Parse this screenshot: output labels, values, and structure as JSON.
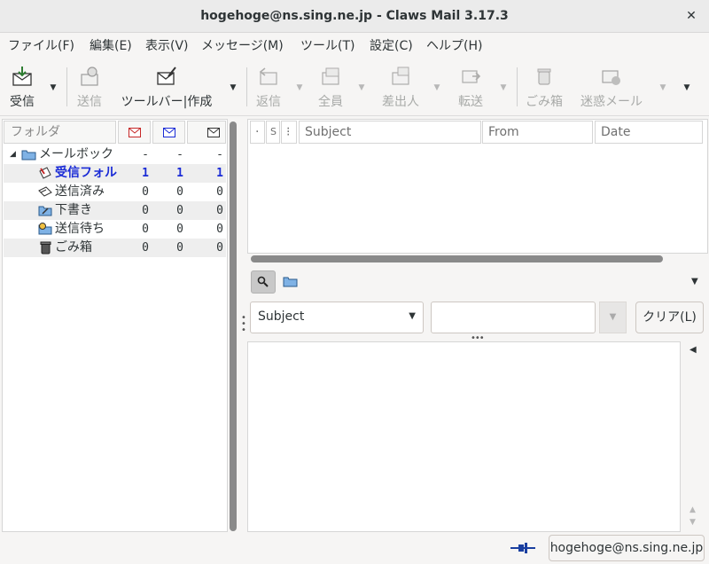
{
  "window": {
    "title": "hogehoge@ns.sing.ne.jp - Claws Mail 3.17.3",
    "close_symbol": "✕"
  },
  "menubar": [
    "ファイル(F)",
    "編集(E)",
    "表示(V)",
    "メッセージ(M)",
    "ツール(T)",
    "設定(C)",
    "ヘルプ(H)"
  ],
  "toolbar": {
    "receive": "受信",
    "send": "送信",
    "compose": "ツールバー|作成",
    "reply": "返信",
    "reply_all": "全員",
    "reply_sender": "差出人",
    "forward": "転送",
    "trash": "ごみ箱",
    "spam": "迷惑メール"
  },
  "folder_pane": {
    "header": "フォルダ",
    "root": {
      "name": "メールボック",
      "new": "-",
      "unread": "-",
      "total": "-"
    },
    "folders": [
      {
        "name": "受信フォル",
        "new": "1",
        "unread": "1",
        "total": "1",
        "icon": "inbox-icon",
        "bold": true
      },
      {
        "name": "送信済み",
        "new": "0",
        "unread": "0",
        "total": "0",
        "icon": "sent-folder-icon"
      },
      {
        "name": "下書き",
        "new": "0",
        "unread": "0",
        "total": "0",
        "icon": "drafts-folder-icon"
      },
      {
        "name": "送信待ち",
        "new": "0",
        "unread": "0",
        "total": "0",
        "icon": "queue-folder-icon"
      },
      {
        "name": "ごみ箱",
        "new": "0",
        "unread": "0",
        "total": "0",
        "icon": "trash-folder-icon"
      }
    ]
  },
  "message_list": {
    "columns": {
      "mark": "·",
      "status": "S",
      "attach": "⁝",
      "subject": "Subject",
      "from": "From",
      "date": "Date"
    }
  },
  "quick_search": {
    "search_type": "Subject",
    "search_value": "",
    "clear_label": "クリア(L)"
  },
  "statusbar": {
    "account": "hogehoge@ns.sing.ne.jp"
  },
  "colors": {
    "unread_folder": "#1a2bd6",
    "accent": "#3584e4"
  }
}
